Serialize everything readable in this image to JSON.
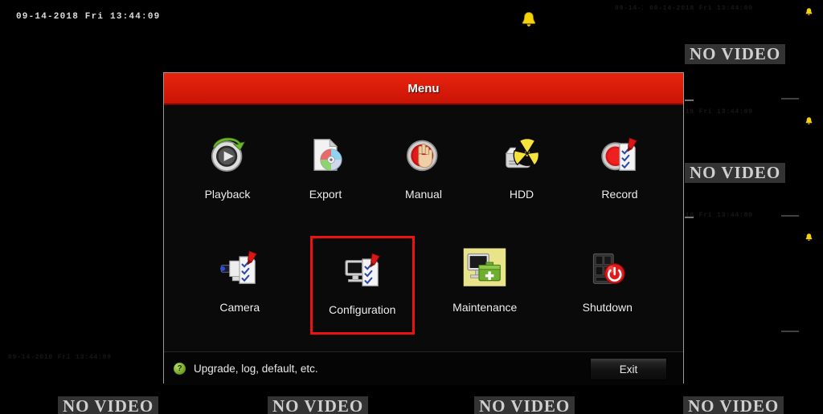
{
  "osd": {
    "main_timestamp": "09-14-2018  Fri 13:44:09",
    "faint_timestamp": "09-14-2018 Fri 13:44:09",
    "no_video_label": "NO VIDEO"
  },
  "status_icons": {
    "alarm_bell": "bell-icon"
  },
  "dialog": {
    "title": "Menu",
    "items": [
      {
        "label": "Playback",
        "icon": "playback-icon",
        "selected": false
      },
      {
        "label": "Export",
        "icon": "export-icon",
        "selected": false
      },
      {
        "label": "Manual",
        "icon": "manual-icon",
        "selected": false
      },
      {
        "label": "HDD",
        "icon": "hdd-icon",
        "selected": false
      },
      {
        "label": "Record",
        "icon": "record-icon",
        "selected": false
      },
      {
        "label": "Camera",
        "icon": "camera-icon",
        "selected": false
      },
      {
        "label": "Configuration",
        "icon": "configuration-icon",
        "selected": true
      },
      {
        "label": "Maintenance",
        "icon": "maintenance-icon",
        "selected": false
      },
      {
        "label": "Shutdown",
        "icon": "shutdown-icon",
        "selected": false
      }
    ],
    "footer": {
      "help_icon": "question-mark-icon",
      "hint": "Upgrade, log, default, etc.",
      "exit_label": "Exit"
    }
  },
  "colors": {
    "titlebar_red": "#e8240f",
    "selection_red": "#ee1111",
    "dialog_background": "#0a0a0a",
    "no_video_background": "#333333",
    "help_green": "#6d9e1e"
  }
}
